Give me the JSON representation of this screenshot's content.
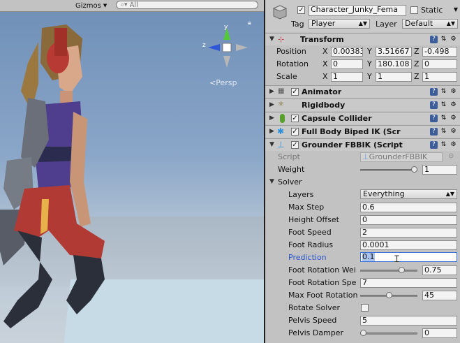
{
  "scene": {
    "gizmos_label": "Gizmos",
    "search_placeholder": "All",
    "persp_label": "Persp",
    "gizmo_axes": {
      "y": "y",
      "z": "z"
    }
  },
  "object_header": {
    "name": "Character_Junky_Fema",
    "static_label": "Static",
    "tag_label": "Tag",
    "tag_value": "Player",
    "layer_label": "Layer",
    "layer_value": "Default"
  },
  "transform": {
    "title": "Transform",
    "position": {
      "label": "Position",
      "x": "0.00383",
      "y": "3.51667",
      "z": "-0.498"
    },
    "rotation": {
      "label": "Rotation",
      "x": "0",
      "y": "180.108",
      "z": "0"
    },
    "scale": {
      "label": "Scale",
      "x": "1",
      "y": "1",
      "z": "1"
    },
    "axis_labels": {
      "x": "X",
      "y": "Y",
      "z": "Z"
    }
  },
  "components": [
    {
      "name": "Animator",
      "has_checkbox": true
    },
    {
      "name": "Rigidbody",
      "has_checkbox": false
    },
    {
      "name": "Capsule Collider",
      "has_checkbox": true
    },
    {
      "name": "Full Body Biped IK (Scr",
      "has_checkbox": true
    },
    {
      "name": "Grounder FBBIK (Script",
      "has_checkbox": true
    }
  ],
  "grounder": {
    "script_label": "Script",
    "script_value": "GrounderFBBIK",
    "weight_label": "Weight",
    "weight_value": "1",
    "weight_fraction": 1.0,
    "solver_label": "Solver",
    "layers": {
      "label": "Layers",
      "value": "Everything"
    },
    "max_step": {
      "label": "Max Step",
      "value": "0.6"
    },
    "height_offset": {
      "label": "Height Offset",
      "value": "0"
    },
    "foot_speed": {
      "label": "Foot Speed",
      "value": "2"
    },
    "foot_radius": {
      "label": "Foot Radius",
      "value": "0.0001"
    },
    "prediction": {
      "label": "Prediction",
      "value": "0.1"
    },
    "foot_rotation_weight": {
      "label": "Foot Rotation Wei",
      "value": "0.75",
      "fraction": 0.75
    },
    "foot_rotation_speed": {
      "label": "Foot Rotation Spe",
      "value": "7"
    },
    "max_foot_rotation": {
      "label": "Max Foot Rotation",
      "value": "45",
      "fraction": 0.5
    },
    "rotate_solver": {
      "label": "Rotate Solver",
      "checked": false
    },
    "pelvis_speed": {
      "label": "Pelvis Speed",
      "value": "5"
    },
    "pelvis_damper": {
      "label": "Pelvis Damper",
      "value": "0",
      "fraction": 0.0
    }
  },
  "colors": {
    "accent_blue": "#3a6fd8",
    "inspector_bg": "#c2c2c2"
  }
}
